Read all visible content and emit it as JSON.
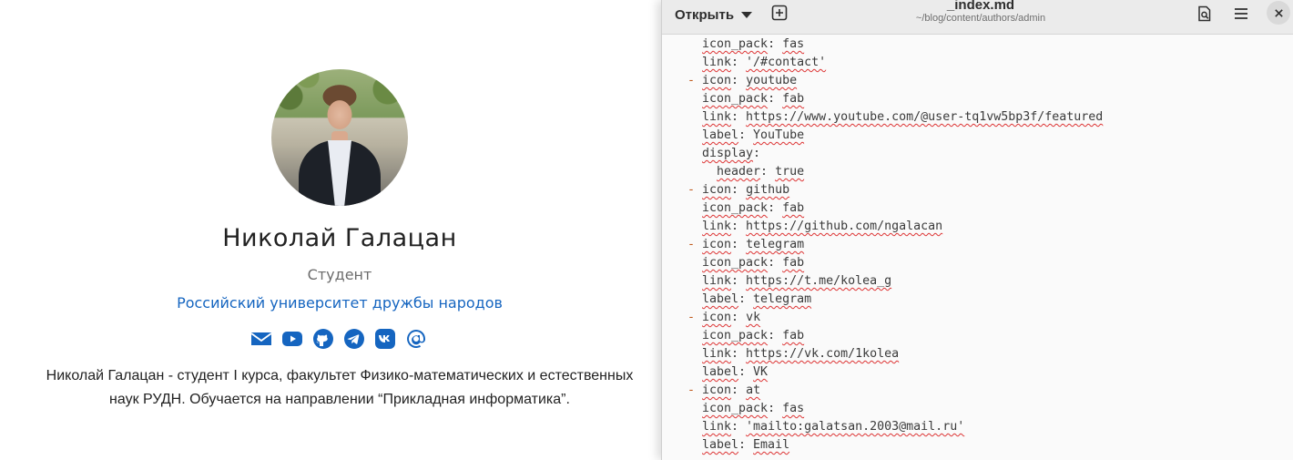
{
  "profile": {
    "name": "Николай Галацан",
    "role": "Студент",
    "organization": "Российский университет дружбы народов",
    "bio_line1": "Николай Галацан - студент I курса, факультет Физико-математических и естественных",
    "bio_line2": "наук РУДН. Обучается на направлении “Прикладная информатика”.",
    "social_icons": [
      "envelope-icon",
      "youtube-icon",
      "github-icon",
      "telegram-icon",
      "vk-icon",
      "at-icon"
    ],
    "accent_color": "#1565c0"
  },
  "editor": {
    "open_label": "Открыть",
    "title": "_index.md",
    "path": "~/blog/content/authors/admin",
    "header_icons": [
      "new-tab-icon",
      "search-icon",
      "menu-icon",
      "close-icon"
    ],
    "lines": [
      {
        "indent": "  ",
        "dash": "",
        "key": "icon_pack",
        "sep": ": ",
        "value": "fas"
      },
      {
        "indent": "  ",
        "dash": "",
        "key": "link",
        "sep": ": ",
        "value": "'/#contact'"
      },
      {
        "indent": "",
        "dash": "- ",
        "key": "icon",
        "sep": ": ",
        "value": "youtube"
      },
      {
        "indent": "  ",
        "dash": "",
        "key": "icon_pack",
        "sep": ": ",
        "value": "fab"
      },
      {
        "indent": "  ",
        "dash": "",
        "key": "link",
        "sep": ": ",
        "value": "https://www.youtube.com/@user-tq1vw5bp3f/featured"
      },
      {
        "indent": "  ",
        "dash": "",
        "key": "label",
        "sep": ": ",
        "value": "YouTube"
      },
      {
        "indent": "  ",
        "dash": "",
        "key": "display",
        "sep": ":",
        "value": ""
      },
      {
        "indent": "    ",
        "dash": "",
        "key": "header",
        "sep": ": ",
        "value": "true"
      },
      {
        "indent": "",
        "dash": "- ",
        "key": "icon",
        "sep": ": ",
        "value": "github"
      },
      {
        "indent": "  ",
        "dash": "",
        "key": "icon_pack",
        "sep": ": ",
        "value": "fab"
      },
      {
        "indent": "  ",
        "dash": "",
        "key": "link",
        "sep": ": ",
        "value": "https://github.com/ngalacan"
      },
      {
        "indent": "",
        "dash": "- ",
        "key": "icon",
        "sep": ": ",
        "value": "telegram"
      },
      {
        "indent": "  ",
        "dash": "",
        "key": "icon_pack",
        "sep": ": ",
        "value": "fab"
      },
      {
        "indent": "  ",
        "dash": "",
        "key": "link",
        "sep": ": ",
        "value": "https://t.me/kolea_g"
      },
      {
        "indent": "  ",
        "dash": "",
        "key": "label",
        "sep": ": ",
        "value": "telegram"
      },
      {
        "indent": "",
        "dash": "- ",
        "key": "icon",
        "sep": ": ",
        "value": "vk"
      },
      {
        "indent": "  ",
        "dash": "",
        "key": "icon_pack",
        "sep": ": ",
        "value": "fab"
      },
      {
        "indent": "  ",
        "dash": "",
        "key": "link",
        "sep": ": ",
        "value": "https://vk.com/1kolea"
      },
      {
        "indent": "  ",
        "dash": "",
        "key": "label",
        "sep": ": ",
        "value": "VK"
      },
      {
        "indent": "",
        "dash": "- ",
        "key": "icon",
        "sep": ": ",
        "value": "at"
      },
      {
        "indent": "  ",
        "dash": "",
        "key": "icon_pack",
        "sep": ": ",
        "value": "fas"
      },
      {
        "indent": "  ",
        "dash": "",
        "key": "link",
        "sep": ": ",
        "value": "'mailto:galatsan.2003@mail.ru'"
      },
      {
        "indent": "  ",
        "dash": "",
        "key": "label",
        "sep": ": ",
        "value": "Email"
      }
    ]
  }
}
